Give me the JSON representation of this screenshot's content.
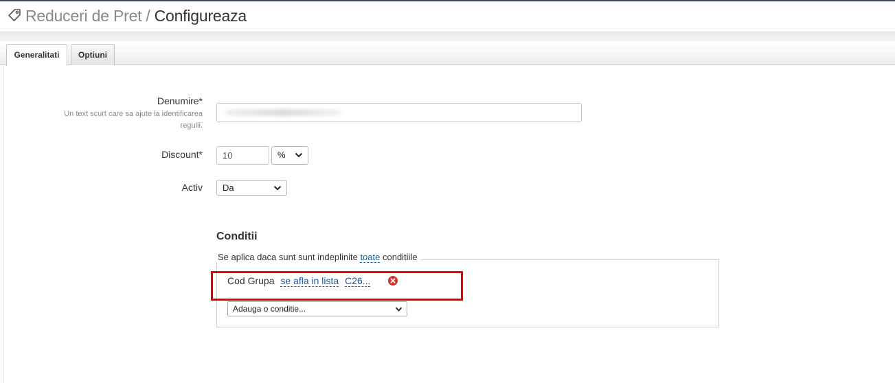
{
  "header": {
    "section": "Reduceri de Pret",
    "separator": "/",
    "current": "Configureaza"
  },
  "tabs": [
    {
      "label": "Generalitati",
      "active": true
    },
    {
      "label": "Optiuni",
      "active": false
    }
  ],
  "form": {
    "name": {
      "label": "Denumire*",
      "hint": "Un text scurt care sa ajute la identificarea regulii.",
      "value": ""
    },
    "discount": {
      "label": "Discount*",
      "value": "10",
      "unit": "%"
    },
    "active": {
      "label": "Activ",
      "value": "Da"
    }
  },
  "conditions": {
    "title": "Conditii",
    "legend_prefix": "Se aplica daca sunt sunt indeplinite",
    "legend_link": "toate",
    "legend_suffix": "conditiile",
    "rows": [
      {
        "field": "Cod Grupa",
        "operator": "se afla in lista",
        "value": "C26..."
      }
    ],
    "add_placeholder": "Adauga o conditie..."
  },
  "colors": {
    "link": "#1a5aa0",
    "highlight": "#e50000",
    "delete": "#e0302a"
  },
  "icons": {
    "title": "tag-icon",
    "delete": "delete-icon",
    "dropdown": "chevron-down-icon"
  }
}
